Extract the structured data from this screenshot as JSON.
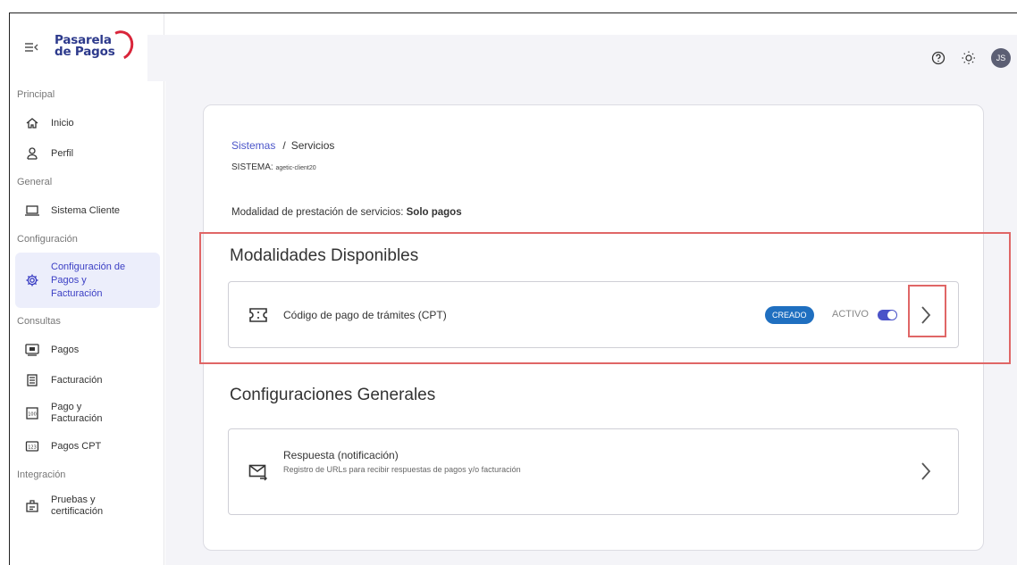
{
  "brand": {
    "logo_line1": "Pasarela",
    "logo_line2": "de Pagos"
  },
  "topbar": {
    "avatar_initials": "JS",
    "help_icon": "help-circle-icon",
    "theme_icon": "sun-icon"
  },
  "sidebar": {
    "sections": [
      {
        "label": "Principal"
      },
      {
        "label": "General"
      },
      {
        "label": "Configuración"
      },
      {
        "label": "Consultas"
      },
      {
        "label": "Integración"
      }
    ],
    "items": {
      "inicio": "Inicio",
      "perfil": "Perfil",
      "sistema_cliente": "Sistema Cliente",
      "config_pagos_1": "Configuración de",
      "config_pagos_2": "Pagos y",
      "config_pagos_3": "Facturación",
      "pagos": "Pagos",
      "facturacion": "Facturación",
      "pago_fact_1": "Pago y",
      "pago_fact_2": "Facturación",
      "pagos_cpt": "Pagos CPT",
      "pruebas_1": "Pruebas y",
      "pruebas_2": "certificación"
    }
  },
  "breadcrumb": {
    "link": "Sistemas",
    "separator": "/",
    "current": "Servicios"
  },
  "system": {
    "label": "SISTEMA:",
    "value": "agetic-client20"
  },
  "modalidad": {
    "label": "Modalidad de prestación de servicios:",
    "value": "Solo pagos"
  },
  "modalidades": {
    "title": "Modalidades Disponibles",
    "items": [
      {
        "label": "Código de pago de trámites (CPT)",
        "badge": "CREADO",
        "status": "ACTIVO",
        "enabled": true
      }
    ]
  },
  "configuraciones": {
    "title": "Configuraciones Generales",
    "items": [
      {
        "label": "Respuesta (notificación)",
        "description": "Registro de URLs para recibir respuestas de pagos y/o facturación"
      }
    ]
  },
  "colors": {
    "accent": "#4a52c8",
    "badge": "#1f6fc0",
    "highlight": "#e06666",
    "logo_blue": "#2d3a8c",
    "logo_red": "#d9253a"
  }
}
